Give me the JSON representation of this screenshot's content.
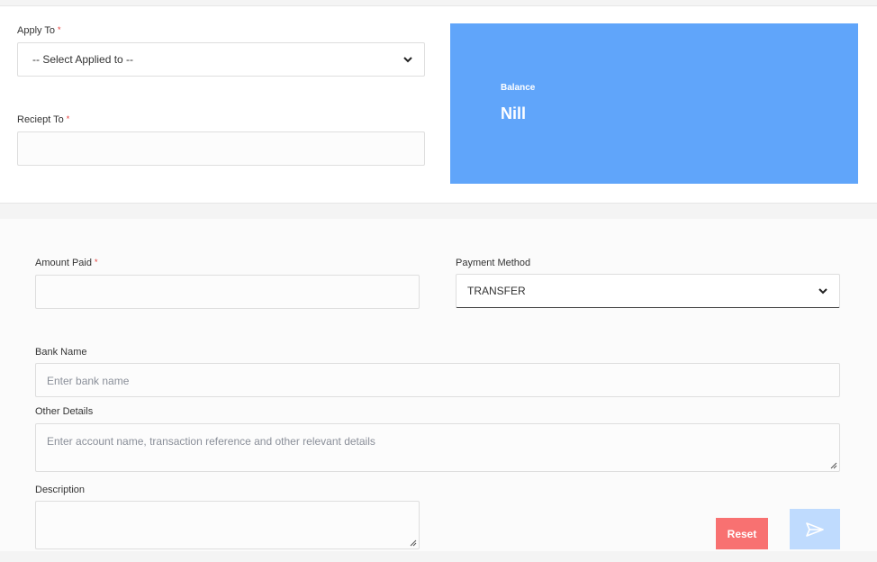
{
  "apply_to": {
    "label": "Apply To",
    "required_mark": "*",
    "selected": "-- Select Applied to --"
  },
  "receipt_to": {
    "label": "Reciept To",
    "required_mark": "*",
    "value": ""
  },
  "balance": {
    "label": "Balance",
    "value": "Nill",
    "color": "#60a5fa"
  },
  "amount_paid": {
    "label": "Amount Paid",
    "required_mark": "*",
    "value": ""
  },
  "payment_method": {
    "label": "Payment Method",
    "selected": "TRANSFER"
  },
  "bank_name": {
    "label": "Bank Name",
    "placeholder": "Enter bank name"
  },
  "other_details": {
    "label": "Other Details",
    "placeholder": "Enter account name, transaction reference and other relevant details"
  },
  "description": {
    "label": "Description",
    "value": ""
  },
  "actions": {
    "reset_label": "Reset",
    "reset_color": "#f87171",
    "submit_icon": "send-icon",
    "submit_color": "#bfdbfe"
  }
}
